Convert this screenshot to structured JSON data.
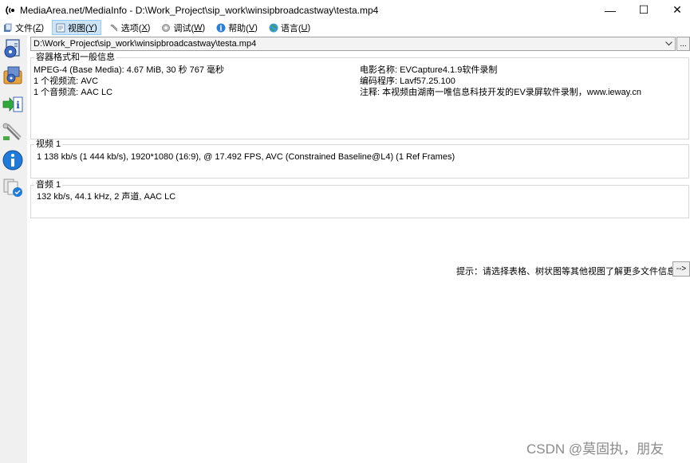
{
  "window": {
    "title": "MediaArea.net/MediaInfo - D:\\Work_Project\\sip_work\\winsipbroadcastway\\testa.mp4",
    "minimize_glyph": "—",
    "maximize_glyph": "☐",
    "close_glyph": "✕"
  },
  "menu": [
    {
      "label": "文件(",
      "key": "Z",
      "tail": ")",
      "icon": "file-menu-icon"
    },
    {
      "label": "视图(",
      "key": "Y",
      "tail": ")",
      "icon": "view-menu-icon"
    },
    {
      "label": "选项(",
      "key": "X",
      "tail": ")",
      "icon": "options-menu-icon"
    },
    {
      "label": "调试(",
      "key": "W",
      "tail": ")",
      "icon": "debug-menu-icon"
    },
    {
      "label": "帮助(",
      "key": "V",
      "tail": ")",
      "icon": "help-menu-icon"
    },
    {
      "label": "语言(",
      "key": "U",
      "tail": ")",
      "icon": "language-menu-icon"
    }
  ],
  "toolbar": {
    "icons": [
      "open-file-icon",
      "open-folder-icon",
      "export-icon",
      "settings-icon",
      "about-icon",
      "check-update-icon"
    ]
  },
  "file": {
    "path": "D:\\Work_Project\\sip_work\\winsipbroadcastway\\testa.mp4",
    "browse_label": "..."
  },
  "general": {
    "title": "容器格式和一般信息",
    "left": [
      "MPEG-4 (Base Media): 4.67 MiB, 30 秒 767 毫秒",
      "1 个视频流: AVC",
      "1 个音频流: AAC LC"
    ],
    "right": [
      "电影名称: EVCapture4.1.9软件录制",
      "编码程序: Lavf57.25.100",
      "注释: 本视频由湖南一唯信息科技开发的EV录屏软件录制，www.ieway.cn"
    ]
  },
  "video": {
    "title": "视频 1",
    "line": "1 138 kb/s (1 444 kb/s), 1920*1080 (16:9), @ 17.492 FPS, AVC (Constrained Baseline@L4) (1 Ref Frames)"
  },
  "audio": {
    "title": "音频 1",
    "line": "132 kb/s, 44.1 kHz, 2 声道, AAC LC"
  },
  "hint": {
    "text": "提示：请选择表格、树状图等其他视图了解更多文件信息",
    "button_label": "-->"
  },
  "watermark": "CSDN @莫固执，朋友"
}
